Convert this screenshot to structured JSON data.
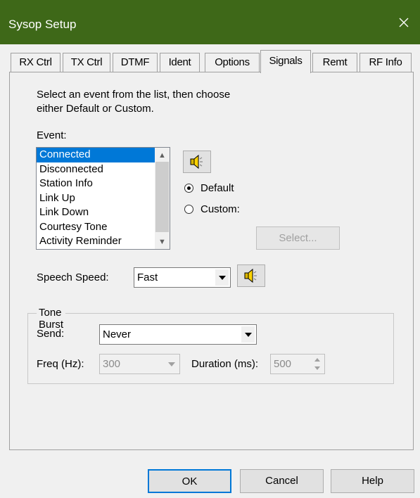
{
  "window": {
    "title": "Sysop Setup",
    "close_glyph": "✕"
  },
  "tabs": [
    {
      "label": "RX Ctrl"
    },
    {
      "label": "TX Ctrl"
    },
    {
      "label": "DTMF"
    },
    {
      "label": "Ident"
    },
    {
      "label": "Options"
    },
    {
      "label": "Signals",
      "active": true
    },
    {
      "label": "Remt"
    },
    {
      "label": "RF Info"
    }
  ],
  "signals": {
    "instruction_line1": "Select an event from the list, then choose",
    "instruction_line2": "either Default or Custom.",
    "event_label": "Event:",
    "events": [
      "Connected",
      "Disconnected",
      "Station Info",
      "Link Up",
      "Link Down",
      "Courtesy Tone",
      "Activity Reminder"
    ],
    "selected_event": "Connected",
    "radio_default_label": "Default",
    "radio_custom_label": "Custom:",
    "selected_radio": "Default",
    "select_button_label": "Select...",
    "speech_speed_label": "Speech Speed:",
    "speech_speed_value": "Fast",
    "tone_burst": {
      "group_label": "Tone Burst",
      "send_label": "Send:",
      "send_value": "Never",
      "freq_label": "Freq (Hz):",
      "freq_value": "300",
      "duration_label": "Duration (ms):",
      "duration_value": "500"
    }
  },
  "footer": {
    "ok_label": "OK",
    "cancel_label": "Cancel",
    "help_label": "Help"
  },
  "colors": {
    "titlebar": "#3e6818",
    "selection": "#0078d7"
  }
}
